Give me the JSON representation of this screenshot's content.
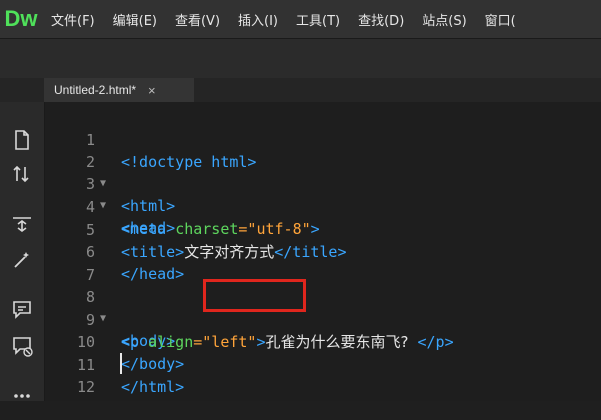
{
  "app": {
    "logo": "Dw"
  },
  "menu": [
    {
      "label": "文件(F)"
    },
    {
      "label": "编辑(E)"
    },
    {
      "label": "查看(V)"
    },
    {
      "label": "插入(I)"
    },
    {
      "label": "工具(T)"
    },
    {
      "label": "查找(D)"
    },
    {
      "label": "站点(S)"
    },
    {
      "label": "窗口("
    }
  ],
  "tab": {
    "label": "Untitled-2.html*",
    "close": "×"
  },
  "left_icons": [
    "document-icon",
    "sort-arrows-icon",
    "expand-icon",
    "wand-icon",
    "comment-icon",
    "comment-remove-icon",
    "more-icon"
  ],
  "editor": {
    "line_numbers": [
      "1",
      "2",
      "3",
      "4",
      "5",
      "6",
      "7",
      "8",
      "9",
      "10",
      "11",
      "12"
    ],
    "lines": [
      {
        "t1": "<!doctype html>"
      },
      {
        "t1": "<html>"
      },
      {
        "t1": "<head>"
      },
      {
        "t1": "<meta ",
        "t2": "charset",
        "t3": "=\"utf-8\"",
        "t4": ">"
      },
      {
        "t1": "<title>",
        "t2": "文字对齐方式",
        "t3": "</title>"
      },
      {
        "t1": "</head>"
      },
      {
        "t1": ""
      },
      {
        "t1": "<body>"
      },
      {
        "t1": "<p ",
        "t2": "align",
        "t3": "=\"left\"",
        "t4": ">",
        "t5": "孔雀为什么要东南飞?",
        "t6": " </p>"
      },
      {
        "t1": "</body>"
      },
      {
        "t1": "</html>"
      },
      {
        "t1": ""
      }
    ],
    "fold_marker": "▼"
  },
  "colors": {
    "tag": "#3aa6ff",
    "attribute": "#5ed65e",
    "string": "#ffa43a",
    "highlight": "#e0261d",
    "logo": "#4fe05a"
  }
}
